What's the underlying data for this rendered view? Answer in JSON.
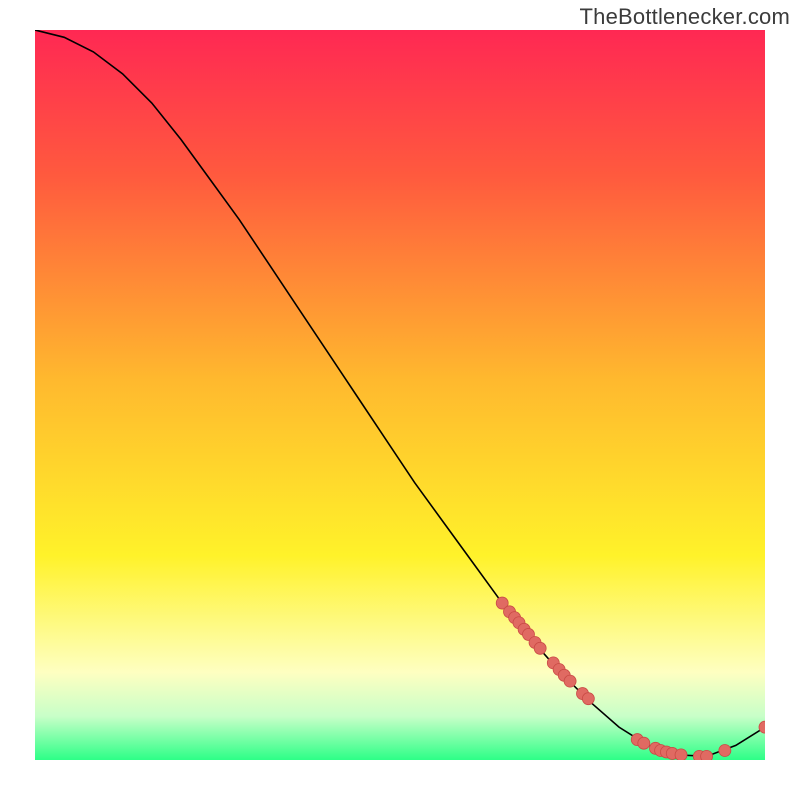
{
  "watermark": "TheBottlenecker.com",
  "colors": {
    "gradient_top": "#ff2853",
    "gradient_upper": "#ff5a3e",
    "gradient_mid": "#ffb92e",
    "gradient_lower": "#fff22a",
    "gradient_yellow_pale": "#feffc1",
    "gradient_green_pale": "#c8ffc8",
    "gradient_green": "#2dff87",
    "line": "#000000",
    "marker_fill": "#e06a62",
    "marker_stroke": "#c94a45"
  },
  "chart_data": {
    "type": "line",
    "title": "",
    "xlabel": "",
    "ylabel": "",
    "xlim": [
      0,
      100
    ],
    "ylim": [
      0,
      100
    ],
    "series": [
      {
        "name": "bottleneck-curve",
        "x": [
          0,
          4,
          8,
          12,
          16,
          20,
          24,
          28,
          32,
          36,
          40,
          44,
          48,
          52,
          56,
          60,
          64,
          68,
          72,
          76,
          80,
          84,
          88,
          92,
          96,
          100
        ],
        "y": [
          100,
          99,
          97,
          94,
          90,
          85,
          79.5,
          74,
          68,
          62,
          56,
          50,
          44,
          38,
          32.5,
          27,
          21.5,
          16.5,
          12,
          8,
          4.5,
          2,
          0.7,
          0.5,
          2,
          4.5
        ]
      }
    ],
    "markers": {
      "name": "data-points",
      "points": [
        {
          "x": 64.0,
          "y": 21.5
        },
        {
          "x": 65.0,
          "y": 20.3
        },
        {
          "x": 65.7,
          "y": 19.5
        },
        {
          "x": 66.3,
          "y": 18.8
        },
        {
          "x": 67.0,
          "y": 17.9
        },
        {
          "x": 67.6,
          "y": 17.2
        },
        {
          "x": 68.5,
          "y": 16.1
        },
        {
          "x": 69.2,
          "y": 15.3
        },
        {
          "x": 71.0,
          "y": 13.3
        },
        {
          "x": 71.8,
          "y": 12.4
        },
        {
          "x": 72.5,
          "y": 11.6
        },
        {
          "x": 73.3,
          "y": 10.8
        },
        {
          "x": 75.0,
          "y": 9.1
        },
        {
          "x": 75.8,
          "y": 8.4
        },
        {
          "x": 82.5,
          "y": 2.8
        },
        {
          "x": 83.4,
          "y": 2.3
        },
        {
          "x": 85.0,
          "y": 1.6
        },
        {
          "x": 85.7,
          "y": 1.3
        },
        {
          "x": 86.5,
          "y": 1.1
        },
        {
          "x": 87.3,
          "y": 0.9
        },
        {
          "x": 88.5,
          "y": 0.7
        },
        {
          "x": 91.0,
          "y": 0.5
        },
        {
          "x": 92.0,
          "y": 0.5
        },
        {
          "x": 94.5,
          "y": 1.3
        },
        {
          "x": 100.0,
          "y": 4.5
        }
      ]
    }
  }
}
